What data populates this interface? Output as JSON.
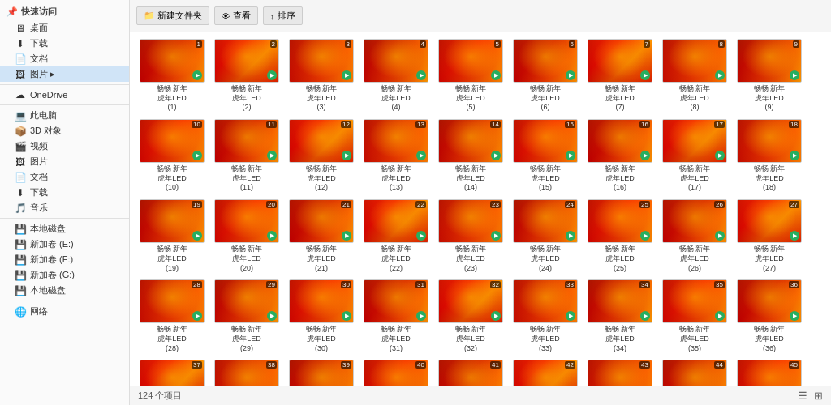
{
  "sidebar": {
    "quick_access_label": "快速访问",
    "items": [
      {
        "id": "desktop",
        "label": "桌面",
        "icon": "🖥",
        "active": false
      },
      {
        "id": "downloads",
        "label": "下载",
        "icon": "⬇",
        "active": false
      },
      {
        "id": "documents",
        "label": "文档",
        "icon": "📄",
        "active": false
      },
      {
        "id": "pictures",
        "label": "图片 ▸",
        "icon": "🖼",
        "active": true
      },
      {
        "id": "onedrive",
        "label": "OneDrive",
        "icon": "☁",
        "active": false
      },
      {
        "id": "thispc",
        "label": "此电脑",
        "icon": "💻",
        "active": false
      },
      {
        "id": "3dobjects",
        "label": "3D 对象",
        "icon": "📦",
        "active": false
      },
      {
        "id": "videos",
        "label": "视频",
        "icon": "🎬",
        "active": false
      },
      {
        "id": "pictures2",
        "label": "图片",
        "icon": "🖼",
        "active": false
      },
      {
        "id": "documents2",
        "label": "文档",
        "icon": "📄",
        "active": false
      },
      {
        "id": "downloads2",
        "label": "下载",
        "icon": "⬇",
        "active": false
      },
      {
        "id": "music",
        "label": "音乐",
        "icon": "🎵",
        "active": false
      },
      {
        "id": "localc",
        "label": "本地磁盘",
        "icon": "💾",
        "active": false
      },
      {
        "id": "newvol1",
        "label": "新加卷 (E:)",
        "icon": "💾",
        "active": false
      },
      {
        "id": "newvol2",
        "label": "新加卷 (F:)",
        "icon": "💾",
        "active": false
      },
      {
        "id": "newvol3",
        "label": "新加卷 (G:)",
        "icon": "💾",
        "active": false
      },
      {
        "id": "localc2",
        "label": "本地磁盘",
        "icon": "💾",
        "active": false
      },
      {
        "id": "network",
        "label": "网络",
        "icon": "🌐",
        "active": false
      }
    ]
  },
  "toolbar": {
    "buttons": [
      "新建文件夹",
      "查看",
      "排序"
    ]
  },
  "statusbar": {
    "count_label": "124 个项目",
    "view_icons": [
      "☰",
      "⊞"
    ]
  },
  "files": {
    "prefix": "畅畅 新年虎年LED",
    "total": 124,
    "items": []
  }
}
